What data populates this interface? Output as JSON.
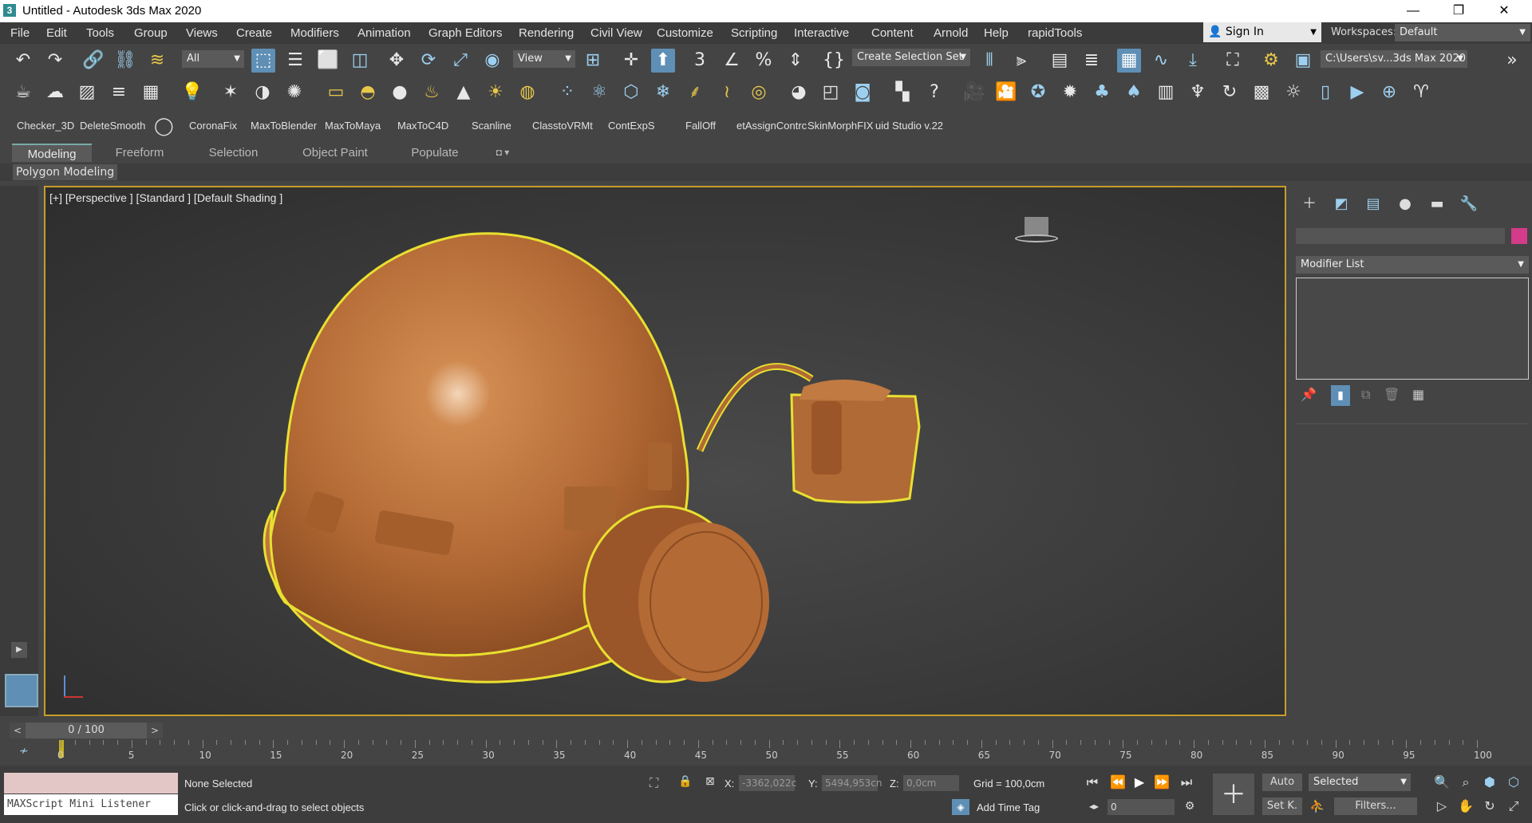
{
  "window": {
    "title": "Untitled - Autodesk 3ds Max 2020",
    "app_icon": "3"
  },
  "menu": [
    "File",
    "Edit",
    "Tools",
    "Group",
    "Views",
    "Create",
    "Modifiers",
    "Animation",
    "Graph Editors",
    "Rendering",
    "Civil View",
    "Customize",
    "Scripting",
    "Interactive",
    "Content",
    "Arnold",
    "Help",
    "rapidTools"
  ],
  "signin": "Sign In",
  "workspaces": {
    "label": "Workspaces:",
    "value": "Default"
  },
  "toolbar": {
    "filter": "All",
    "refcoord": "View",
    "selection_set": "Create Selection Set",
    "project_path": "C:\\Users\\sv...3ds Max 2020"
  },
  "scripts": [
    "Checker_3D",
    "DeleteSmooth",
    "CoronaFix",
    "MaxToBlender",
    "MaxToMaya",
    "MaxToC4D",
    "Scanline",
    "ClasstoVRMt",
    "ContExpS",
    "FallOff",
    "etAssignContrc",
    "SkinMorphFIX",
    "uid Studio v.22"
  ],
  "ribbon": {
    "tabs": [
      "Modeling",
      "Freeform",
      "Selection",
      "Object Paint",
      "Populate"
    ],
    "active": "Modeling",
    "panel": "Polygon Modeling"
  },
  "viewport": {
    "label": "[+] [Perspective ] [Standard ] [Default Shading ]"
  },
  "command_panel": {
    "modifier_list": "Modifier List",
    "object_color": "#d43b8a"
  },
  "timeline": {
    "frame": "0 / 100",
    "ticks": [
      "0",
      "5",
      "10",
      "15",
      "20",
      "25",
      "30",
      "35",
      "40",
      "45",
      "50",
      "55",
      "60",
      "65",
      "70",
      "75",
      "80",
      "85",
      "90",
      "95",
      "100"
    ]
  },
  "status": {
    "maxscript": "MAXScript Mini Listener",
    "selected": "None Selected",
    "prompt": "Click or click-and-drag to select objects",
    "x_label": "X:",
    "x": "-3362,022c",
    "y_label": "Y:",
    "y": "5494,953cn",
    "z_label": "Z:",
    "z": "0,0cm",
    "grid": "Grid = 100,0cm",
    "add_time_tag": "Add Time Tag",
    "auto": "Auto",
    "set_key": "Set K.",
    "key_filter": "Selected",
    "filters": "Filters...",
    "frame_field": "0"
  }
}
